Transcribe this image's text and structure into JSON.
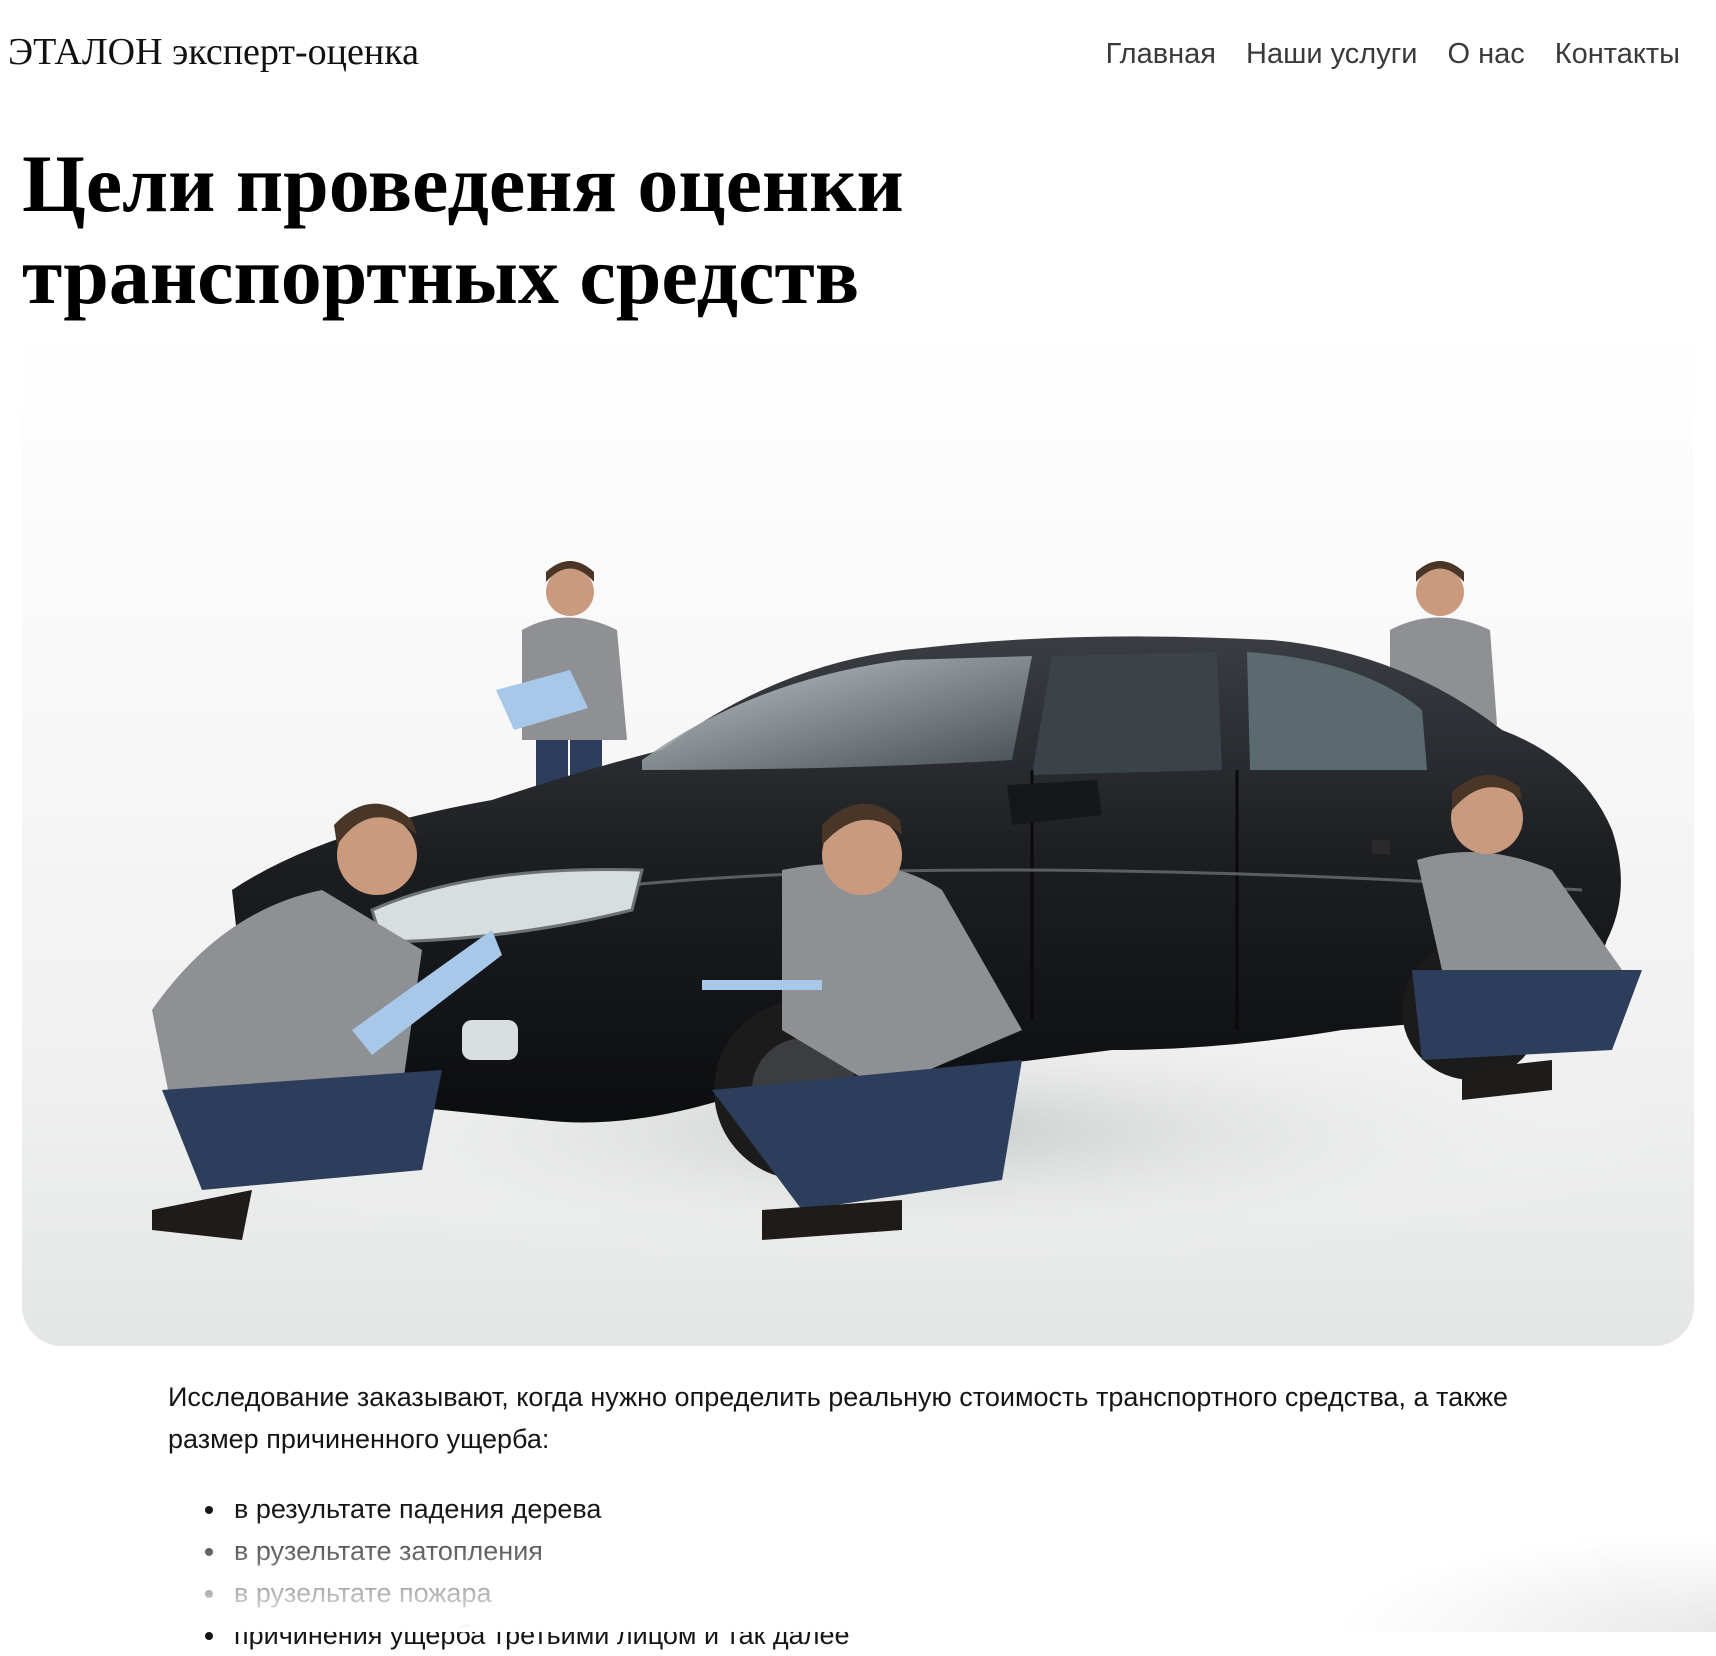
{
  "header": {
    "brand": "ЭТАЛОН эксперт-оценка",
    "nav": [
      {
        "label": "Главная"
      },
      {
        "label": "Наши услуги"
      },
      {
        "label": "О нас"
      },
      {
        "label": "Контакты"
      }
    ]
  },
  "main": {
    "title": "Цели проведеня оценки транспортных средств",
    "hero_image": "photo of a black sedan inspected by appraisers",
    "intro": "Исследование заказывают, когда нужно определить реальную стоимость транспортного средства, а также размер причиненного ущерба:",
    "bullets": [
      "в результате падения дерева",
      "в рузельтате затопления",
      "в рузельтате пожара",
      "причинения ущерба третьими лицом и так далее"
    ]
  },
  "colors": {
    "text": "#111111",
    "nav_text": "#3a3a3a",
    "background": "#ffffff",
    "car_body": "#1c1e22",
    "sweater": "#8e9094",
    "jeans": "#2c3e5c"
  }
}
